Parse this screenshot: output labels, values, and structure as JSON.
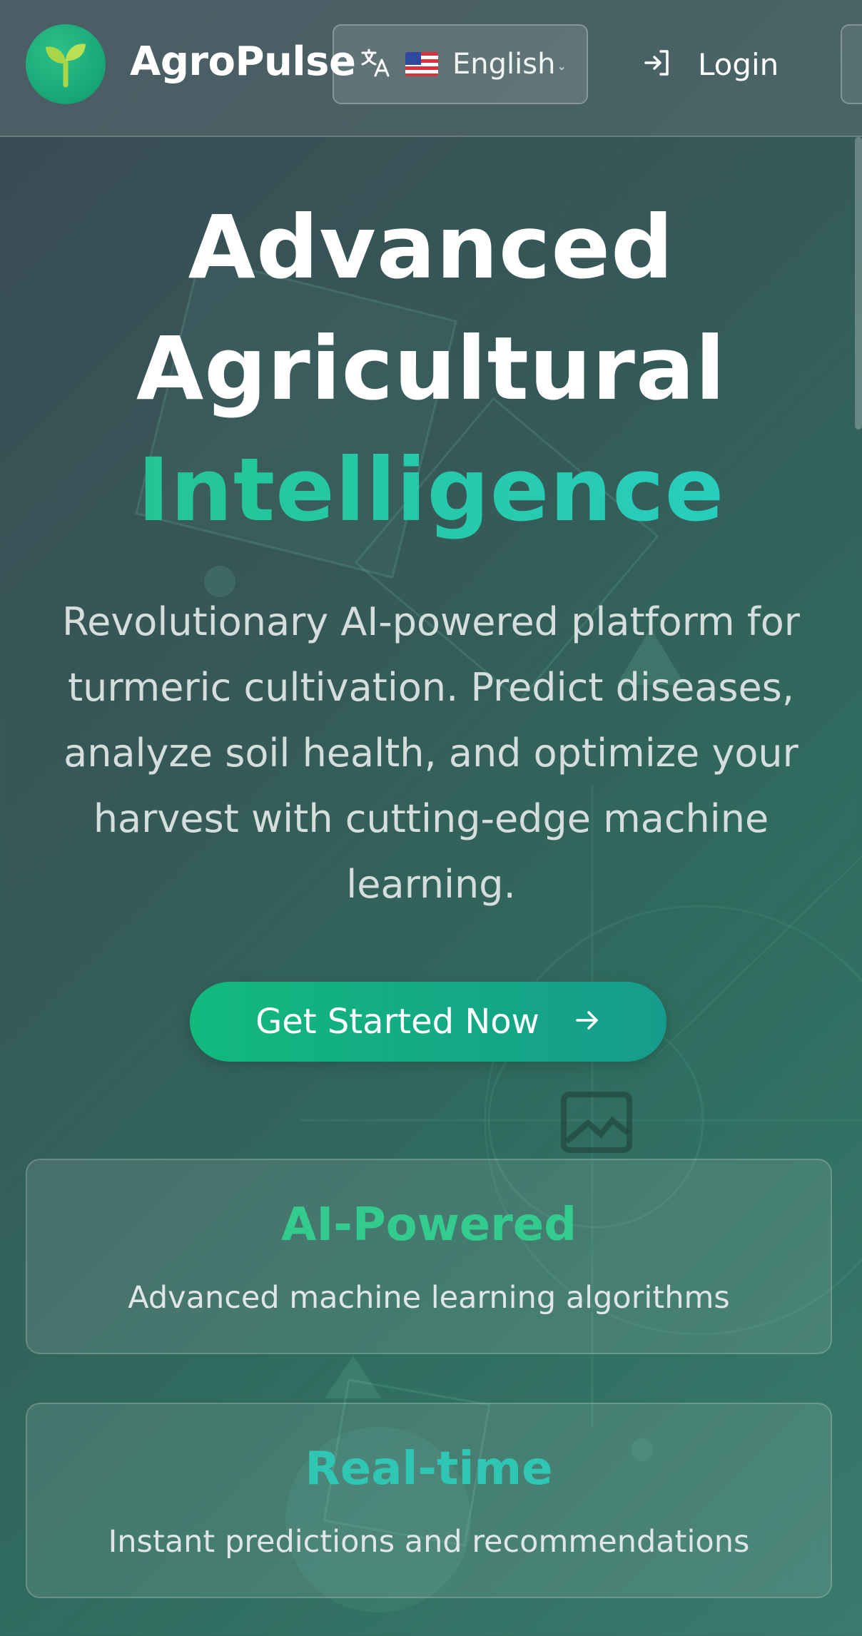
{
  "header": {
    "brand": "AgroPulse",
    "logo_icon": "sprout-icon",
    "language": {
      "label": "English",
      "flag": "us-flag-icon",
      "icon": "translate-icon"
    },
    "login_label": "Login",
    "login_icon": "login-arrow-icon"
  },
  "hero": {
    "title_line1": "Advanced",
    "title_line2": "Agricultural",
    "title_accent": "Intelligence",
    "subtitle": "Revolutionary AI-powered platform for turmeric cultivation. Predict diseases, analyze soil health, and optimize your harvest with cutting-edge machine learning.",
    "cta_label": "Get Started Now",
    "cta_icon": "arrow-right-icon"
  },
  "features": [
    {
      "title": "AI-Powered",
      "description": "Advanced machine learning algorithms"
    },
    {
      "title": "Real-time",
      "description": "Instant predictions and recommendations"
    }
  ],
  "colors": {
    "accent_green": "#22c38a",
    "accent_teal": "#2ad0c8",
    "cta_start": "#12b97d",
    "cta_end": "#169c8c"
  }
}
